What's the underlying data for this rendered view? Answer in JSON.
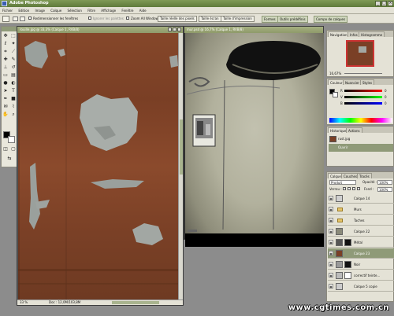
{
  "titlebar": {
    "title": "Adobe Photoshop",
    "btn_min": "_",
    "btn_max": "□",
    "btn_close": "×"
  },
  "menu": [
    "Fichier",
    "Edition",
    "Image",
    "Calque",
    "Sélection",
    "Filtre",
    "Affichage",
    "Fenêtre",
    "Aide"
  ],
  "options": {
    "label_resize": "Redimensionner les fenêtres",
    "label_ignore": "Ignorer les palettes",
    "label_zoom_all": "Zoom All Windows",
    "btn_actual": "Taille réelle des pixels",
    "btn_fit": "Taille écran",
    "btn_print": "Taille d'impression",
    "palette_tabs": [
      "Formes",
      "Outils prédéfinis",
      "Compo de calques"
    ]
  },
  "doc1": {
    "title": "rouille.jpg @ 33,3% (Calque 1, RVB/8)",
    "zoom": "33 %",
    "doc_size": "Doc : 12,0M/103,8M"
  },
  "doc2": {
    "title": "mur.psd @ 16,7% (Calque 1, RVB/8)"
  },
  "navigator": {
    "tabs": [
      "Navigation",
      "Infos",
      "Histogramme"
    ],
    "zoom": "16,67%"
  },
  "color": {
    "tabs": [
      "Couleur",
      "Nuancier",
      "Styles"
    ],
    "r_label": "R",
    "g_label": "V",
    "b_label": "B",
    "r": "0",
    "g": "0",
    "b": "0"
  },
  "history": {
    "tabs": [
      "Historique",
      "Actions"
    ],
    "items": [
      "rust.jpg",
      "Ouvrir"
    ]
  },
  "layers": {
    "tabs": [
      "Calques",
      "Couches",
      "Tracés"
    ],
    "blend_mode": "Produit",
    "opacity_label": "Opacité :",
    "opacity": "100%",
    "lock_label": "Verrou :",
    "fill_label": "Fond :",
    "fill": "100%",
    "rows": [
      {
        "name": "Calque 14",
        "kind": "layer",
        "thumb": "#cfcfcf",
        "mask": false,
        "selected": false
      },
      {
        "name": "Murs",
        "kind": "group",
        "thumb": "",
        "mask": false,
        "selected": false
      },
      {
        "name": "Taches",
        "kind": "group",
        "thumb": "",
        "mask": false,
        "selected": false
      },
      {
        "name": "Calque 22",
        "kind": "layer",
        "thumb": "#8a8a7a",
        "mask": false,
        "selected": false
      },
      {
        "name": "Métal",
        "kind": "layer",
        "thumb": "#555",
        "mask": true,
        "selected": false
      },
      {
        "name": "Calque 23",
        "kind": "layer",
        "thumb": "#7a4026",
        "mask": false,
        "selected": true
      },
      {
        "name": "Noir",
        "kind": "layer",
        "thumb": "#999",
        "mask": true,
        "selected": false
      },
      {
        "name": "correctif teinte...",
        "kind": "layer",
        "thumb": "#bbb",
        "mask": true,
        "selected": false
      },
      {
        "name": "Calque 5 copie",
        "kind": "layer",
        "thumb": "#ccc",
        "mask": false,
        "selected": false
      }
    ]
  },
  "watermark": "www.cgtimes.com.cn"
}
